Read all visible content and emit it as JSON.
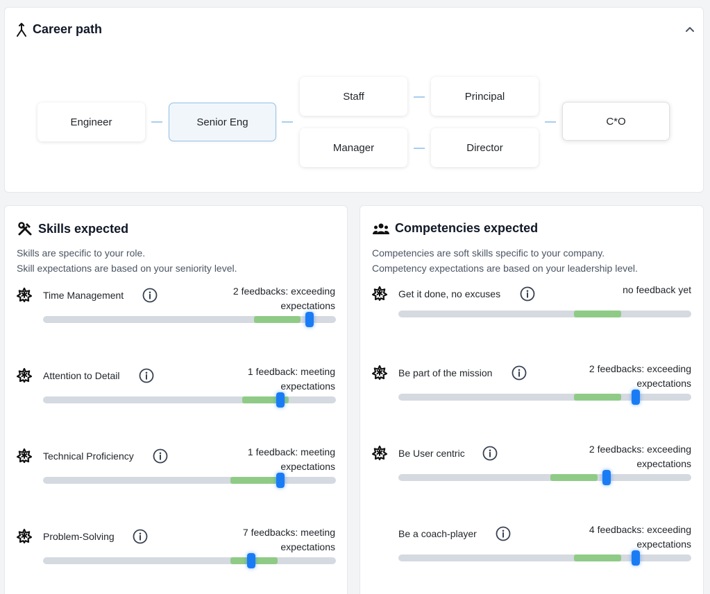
{
  "career": {
    "title": "Career path",
    "nodes": [
      "Engineer",
      "Senior Eng",
      "Staff",
      "Manager",
      "Principal",
      "Director",
      "C*O"
    ],
    "current": "Senior Eng"
  },
  "skills": {
    "title": "Skills expected",
    "desc_line1": "Skills are specific to your role.",
    "desc_line2": "Skill expectations are based on your seniority level.",
    "items": [
      {
        "name": "Time Management",
        "feedback_line1": "2 feedbacks: exceeding",
        "feedback_line2": "expectations",
        "expected_range": [
          0.72,
          0.88
        ],
        "marker": 0.91
      },
      {
        "name": "Attention to Detail",
        "feedback_line1": "1 feedback: meeting",
        "feedback_line2": "expectations",
        "expected_range": [
          0.68,
          0.84
        ],
        "marker": 0.81
      },
      {
        "name": "Technical Proficiency",
        "feedback_line1": "1 feedback: meeting",
        "feedback_line2": "expectations",
        "expected_range": [
          0.64,
          0.81
        ],
        "marker": 0.81
      },
      {
        "name": "Problem-Solving",
        "feedback_line1": "7 feedbacks: meeting",
        "feedback_line2": "expectations",
        "expected_range": [
          0.64,
          0.8
        ],
        "marker": 0.71
      }
    ]
  },
  "competencies": {
    "title": "Competencies expected",
    "desc_line1": "Competencies are soft skills specific to your company.",
    "desc_line2": "Competency expectations are based on your leadership level.",
    "items": [
      {
        "name": "Get it done, no excuses",
        "feedback_line1": "no feedback yet",
        "feedback_line2": "",
        "expected_range": [
          0.6,
          0.76
        ],
        "marker": null
      },
      {
        "name": "Be part of the mission",
        "feedback_line1": "2 feedbacks: exceeding",
        "feedback_line2": "expectations",
        "expected_range": [
          0.6,
          0.76
        ],
        "marker": 0.81
      },
      {
        "name": "Be User centric",
        "feedback_line1": "2 feedbacks: exceeding",
        "feedback_line2": "expectations",
        "expected_range": [
          0.52,
          0.68
        ],
        "marker": 0.71
      },
      {
        "name": "Be a coach-player",
        "feedback_line1": "4 feedbacks: exceeding",
        "feedback_line2": "expectations",
        "expected_range": [
          0.6,
          0.76
        ],
        "marker": 0.81
      }
    ]
  },
  "icons": {
    "career": "career-fork-icon",
    "skills": "tools-icon",
    "competencies": "people-group-icon",
    "collapse": "chevron-up-icon",
    "row": "skill-badge-icon",
    "info": "info-icon"
  },
  "colors": {
    "marker": "#1a7cf5",
    "expected_range": "#8fcb86",
    "track": "#d5d9e0",
    "connector": "#a9cdee",
    "current_border": "#90c2e8"
  }
}
